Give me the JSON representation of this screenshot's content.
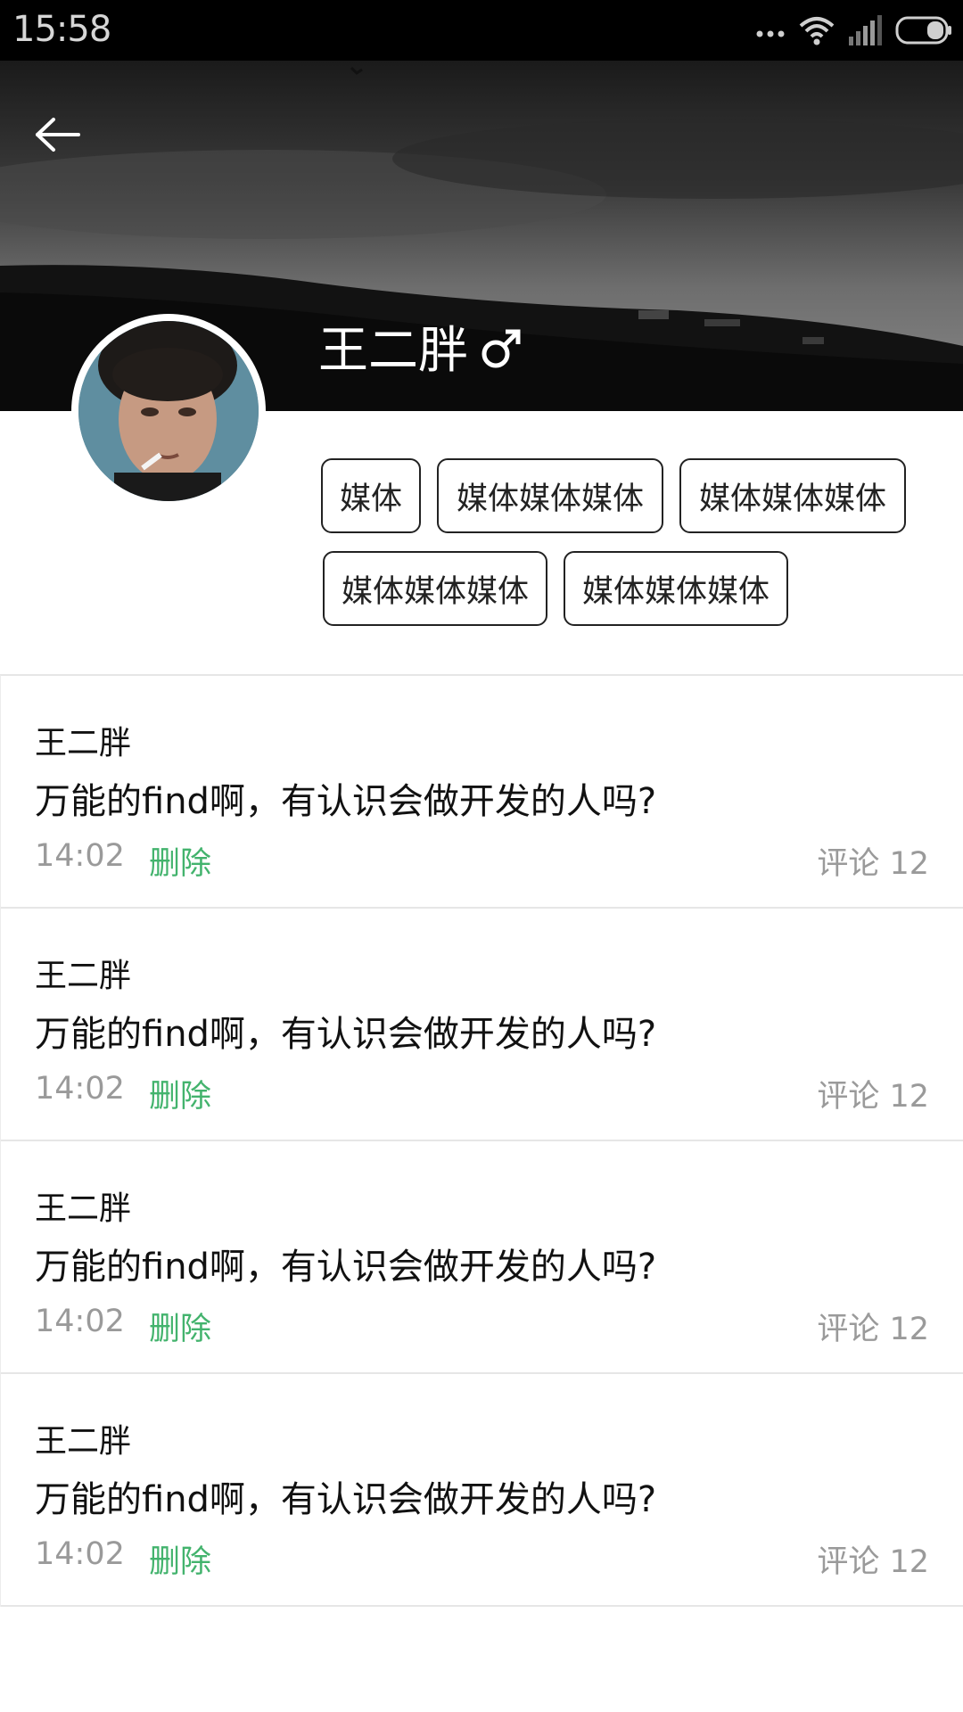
{
  "status_bar": {
    "time": "15:58",
    "icons": [
      "more-dots-icon",
      "wifi-icon",
      "signal-icon",
      "battery-icon"
    ]
  },
  "header": {
    "back_icon": "arrow-left-icon",
    "name": "王二胖",
    "gender_symbol": "♂"
  },
  "tags": [
    "媒体",
    "媒体媒体媒体",
    "媒体媒体媒体",
    "媒体媒体媒体",
    "媒体媒体媒体"
  ],
  "posts": [
    {
      "author": "王二胖",
      "content": "万能的find啊，有认识会做开发的人吗?",
      "time": "14:02",
      "delete_label": "删除",
      "comments": "评论 12"
    },
    {
      "author": "王二胖",
      "content": "万能的find啊，有认识会做开发的人吗?",
      "time": "14:02",
      "delete_label": "删除",
      "comments": "评论 12"
    },
    {
      "author": "王二胖",
      "content": "万能的find啊，有认识会做开发的人吗?",
      "time": "14:02",
      "delete_label": "删除",
      "comments": "评论 12"
    },
    {
      "author": "王二胖",
      "content": "万能的find啊，有认识会做开发的人吗?",
      "time": "14:02",
      "delete_label": "删除",
      "comments": "评论 12"
    }
  ],
  "colors": {
    "accent_green": "#43b36d",
    "muted_gray": "#9a9a9a"
  }
}
